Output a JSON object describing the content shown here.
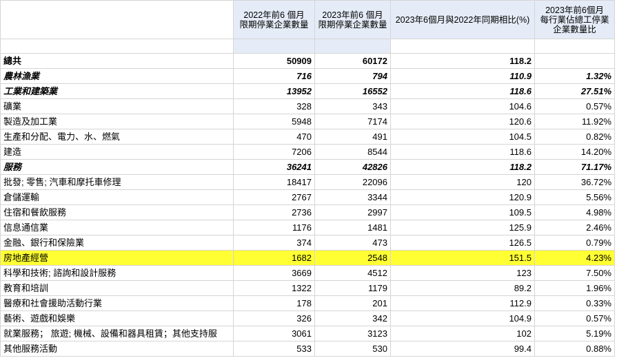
{
  "headers": [
    "",
    "2022年前6 個月\n限期停業企業數量",
    "2023年前6 個月\n限期停業企業數量",
    "2023年6個月與2022年同期相比(%)",
    "2023年前6個月\n每行業佔總工停業\n企業數量比"
  ],
  "highlight_color": "#ffff33",
  "header_color": "#e5ecf7",
  "rows": [
    {
      "label": "總共",
      "v2022": "50909",
      "v2023": "60172",
      "ratio": "118.2",
      "share": "",
      "style": "total"
    },
    {
      "label": "農林漁業",
      "v2022": "716",
      "v2023": "794",
      "ratio": "110.9",
      "share": "1.32%",
      "style": "sector"
    },
    {
      "label": "工業和建築業",
      "v2022": "13952",
      "v2023": "16552",
      "ratio": "118.6",
      "share": "27.51%",
      "style": "sector"
    },
    {
      "label": "礦業",
      "v2022": "328",
      "v2023": "343",
      "ratio": "104.6",
      "share": "0.57%",
      "style": "normal"
    },
    {
      "label": "製造及加工業",
      "v2022": "5948",
      "v2023": "7174",
      "ratio": "120.6",
      "share": "11.92%",
      "style": "normal"
    },
    {
      "label": "生產和分配、電力、水、燃氣",
      "v2022": "470",
      "v2023": "491",
      "ratio": "104.5",
      "share": "0.82%",
      "style": "normal"
    },
    {
      "label": "建造",
      "v2022": "7206",
      "v2023": "8544",
      "ratio": "118.6",
      "share": "14.20%",
      "style": "normal"
    },
    {
      "label": "服務",
      "v2022": "36241",
      "v2023": "42826",
      "ratio": "118.2",
      "share": "71.17%",
      "style": "sector"
    },
    {
      "label": "批發; 零售; 汽車和摩托車修理",
      "v2022": "18417",
      "v2023": "22096",
      "ratio": "120",
      "share": "36.72%",
      "style": "normal"
    },
    {
      "label": "倉儲運輸",
      "v2022": "2767",
      "v2023": "3344",
      "ratio": "120.9",
      "share": "5.56%",
      "style": "normal"
    },
    {
      "label": "住宿和餐飲服務",
      "v2022": "2736",
      "v2023": "2997",
      "ratio": "109.5",
      "share": "4.98%",
      "style": "normal"
    },
    {
      "label": "信息通信業",
      "v2022": "1176",
      "v2023": "1481",
      "ratio": "125.9",
      "share": "2.46%",
      "style": "normal"
    },
    {
      "label": "金融、銀行和保險業",
      "v2022": "374",
      "v2023": "473",
      "ratio": "126.5",
      "share": "0.79%",
      "style": "normal"
    },
    {
      "label": "房地產經營",
      "v2022": "1682",
      "v2023": "2548",
      "ratio": "151.5",
      "share": "4.23%",
      "style": "hl"
    },
    {
      "label": "科學和技術; 諮詢和設計服務",
      "v2022": "3669",
      "v2023": "4512",
      "ratio": "123",
      "share": "7.50%",
      "style": "normal"
    },
    {
      "label": "教育和培訓",
      "v2022": "1322",
      "v2023": "1179",
      "ratio": "89.2",
      "share": "1.96%",
      "style": "normal"
    },
    {
      "label": "醫療和社會援助活動行業",
      "v2022": "178",
      "v2023": "201",
      "ratio": "112.9",
      "share": "0.33%",
      "style": "normal"
    },
    {
      "label": "藝術、遊戲和娛樂",
      "v2022": "326",
      "v2023": "342",
      "ratio": "104.9",
      "share": "0.57%",
      "style": "normal"
    },
    {
      "label": "就業服務； 旅遊; 機械、設備和器具租賃；其他支持服",
      "v2022": "3061",
      "v2023": "3123",
      "ratio": "102",
      "share": "5.19%",
      "style": "normal"
    },
    {
      "label": "其他服務活動",
      "v2022": "533",
      "v2023": "530",
      "ratio": "99.4",
      "share": "0.88%",
      "style": "normal"
    }
  ]
}
